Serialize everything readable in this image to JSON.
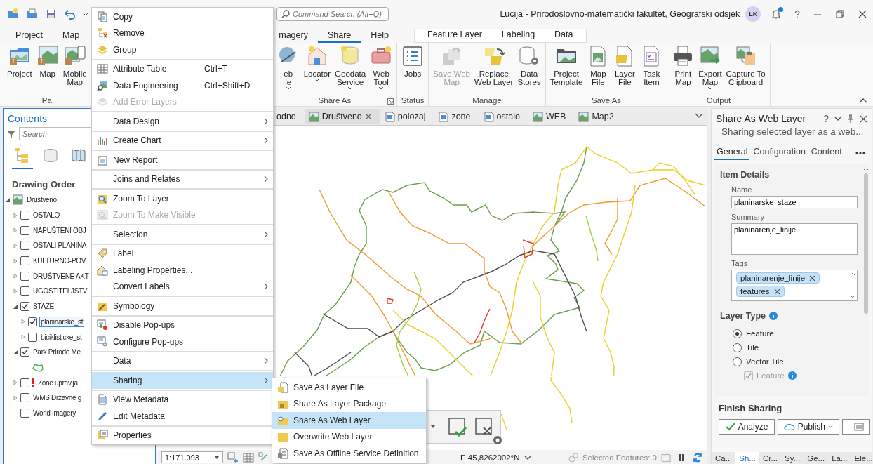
{
  "title_bar": {
    "search": {
      "placeholder": "Command Search (Alt+Q)"
    },
    "title": "Lucija - Prirodoslovno-matematički fakultet, Geografski odsjek",
    "avatar": "LK",
    "notification": true,
    "help": "?"
  },
  "ribbon": {
    "tabs": [
      {
        "label": "Project",
        "selected": false
      },
      {
        "label": "Map",
        "selected": false
      },
      {
        "label": "magery",
        "selected": false
      },
      {
        "label": "Share",
        "selected": true
      },
      {
        "label": "Help",
        "selected": false
      }
    ],
    "contextual_tabs": [
      {
        "label": "Feature Layer",
        "selected": false
      },
      {
        "label": "Labeling",
        "selected": false
      },
      {
        "label": "Data",
        "selected": false
      }
    ],
    "groups": [
      {
        "label": "Pa",
        "buttons": [
          {
            "label": "Project",
            "dropdown": false,
            "disabled": false
          },
          {
            "label": "Map",
            "dropdown": false,
            "disabled": false
          },
          {
            "label": "Mobile\nMap",
            "dropdown": false,
            "disabled": false
          }
        ]
      },
      {
        "label": "Share As",
        "launcher": true,
        "buttons": [
          {
            "label": "eb\nle",
            "dropdown": true,
            "disabled": false
          },
          {
            "label": "Locator",
            "dropdown": true,
            "disabled": false
          },
          {
            "label": "Geodata\nService",
            "dropdown": true,
            "disabled": false
          },
          {
            "label": "Web\nTool",
            "dropdown": true,
            "disabled": false
          }
        ]
      },
      {
        "label": "Status",
        "buttons": [
          {
            "label": "Jobs",
            "dropdown": false,
            "disabled": false
          }
        ]
      },
      {
        "label": "Manage",
        "buttons": [
          {
            "label": "Save Web\nMap",
            "dropdown": false,
            "disabled": true
          },
          {
            "label": "Replace\nWeb Layer",
            "dropdown": false,
            "disabled": false
          },
          {
            "label": "Data\nStores",
            "dropdown": false,
            "disabled": false
          }
        ]
      },
      {
        "label": "Save As",
        "buttons": [
          {
            "label": "Project\nTemplate",
            "dropdown": false,
            "disabled": false
          },
          {
            "label": "Map\nFile",
            "dropdown": false,
            "disabled": false
          },
          {
            "label": "Layer\nFile",
            "dropdown": false,
            "disabled": false
          },
          {
            "label": "Task\nItem",
            "dropdown": false,
            "disabled": false
          }
        ]
      },
      {
        "label": "Output",
        "buttons": [
          {
            "label": "Print\nMap",
            "dropdown": false,
            "disabled": false
          },
          {
            "label": "Export\nMap",
            "dropdown": true,
            "disabled": false
          },
          {
            "label": "Capture To\nClipboard",
            "dropdown": false,
            "disabled": false
          }
        ]
      }
    ]
  },
  "contents": {
    "title": "Contents",
    "search": {
      "placeholder": "Search"
    },
    "views": [
      {
        "selected": true
      },
      {
        "selected": false
      },
      {
        "selected": false
      }
    ],
    "heading": "Drawing Order",
    "tree": [
      {
        "label": "Društveno",
        "kind": "map",
        "expanded": true,
        "children": [
          {
            "label": "OSTALO",
            "kind": "layer",
            "checked": false,
            "expanded": false,
            "selected": false
          },
          {
            "label": "NAPUŠTENI OBJ",
            "kind": "layer",
            "checked": false,
            "expanded": false,
            "selected": false
          },
          {
            "label": "OSTALI PLANINA",
            "kind": "layer",
            "checked": false,
            "expanded": false,
            "selected": false
          },
          {
            "label": "KULTURNO-POV",
            "kind": "layer",
            "checked": false,
            "expanded": false,
            "selected": false
          },
          {
            "label": "DRUŠTVENE AKT",
            "kind": "layer",
            "checked": false,
            "expanded": false,
            "selected": false
          },
          {
            "label": "UGOSTITELJSTV",
            "kind": "layer",
            "checked": false,
            "expanded": false,
            "selected": false
          },
          {
            "label": "STAZE",
            "kind": "layer",
            "checked": true,
            "expanded": true,
            "selected": false,
            "children": [
              {
                "label": "planinarske_st",
                "kind": "layer",
                "checked": true,
                "expanded": false,
                "selected": true
              },
              {
                "label": "biciklisticke_st",
                "kind": "layer",
                "checked": false,
                "expanded": false,
                "selected": false
              }
            ]
          },
          {
            "label": "Park Prirode Me",
            "kind": "layer",
            "checked": true,
            "expanded": true,
            "selected": false,
            "children": [
              {
                "kind": "symbol"
              }
            ]
          },
          {
            "label": "Zone upravlja",
            "kind": "layer",
            "checked": false,
            "expanded": false,
            "selected": false,
            "warning": true
          },
          {
            "label": "WMS Državne g",
            "kind": "layer",
            "checked": false,
            "expanded": false,
            "selected": false
          },
          {
            "label": "World Imagery",
            "kind": "basemap",
            "checked": false,
            "selected": false
          }
        ]
      }
    ]
  },
  "map": {
    "tabs": [
      {
        "label": "odno",
        "kind": "partial",
        "selected": false
      },
      {
        "label": "Društveno",
        "kind": "map",
        "selected": true
      },
      {
        "label": "polozaj",
        "kind": "layout",
        "selected": false
      },
      {
        "label": "zone",
        "kind": "layout",
        "selected": false
      },
      {
        "label": "ostalo",
        "kind": "layout",
        "selected": false
      },
      {
        "label": "WEB",
        "kind": "map",
        "selected": false
      },
      {
        "label": "Map2",
        "kind": "map",
        "selected": false
      }
    ],
    "status_bar": {
      "scale": "1:171.093",
      "coordinates": "E 45,8262002°N",
      "selected_features": "Selected Features: 0"
    }
  },
  "context_menu": {
    "sections": [
      [
        {
          "label": "Copy",
          "submenu": false,
          "disabled": false,
          "selected": false
        },
        {
          "label": "Remove",
          "submenu": false,
          "disabled": false,
          "selected": false
        },
        {
          "label": "Group",
          "submenu": false,
          "disabled": false,
          "selected": false
        }
      ],
      [
        {
          "label": "Attribute Table",
          "shortcut": "Ctrl+T",
          "submenu": false,
          "disabled": false,
          "selected": false
        },
        {
          "label": "Data Engineering",
          "shortcut": "Ctrl+Shift+D",
          "submenu": false,
          "disabled": false,
          "selected": false
        },
        {
          "label": "Add Error Layers",
          "submenu": false,
          "disabled": true,
          "selected": false
        }
      ],
      [
        {
          "label": "Data Design",
          "submenu": true,
          "disabled": false,
          "selected": false
        }
      ],
      [
        {
          "label": "Create Chart",
          "submenu": true,
          "disabled": false,
          "selected": false
        }
      ],
      [
        {
          "label": "New Report",
          "submenu": false,
          "disabled": false,
          "selected": false
        }
      ],
      [
        {
          "label": "Joins and Relates",
          "submenu": true,
          "disabled": false,
          "selected": false
        }
      ],
      [
        {
          "label": "Zoom To Layer",
          "submenu": false,
          "disabled": false,
          "selected": false
        },
        {
          "label": "Zoom To Make Visible",
          "submenu": false,
          "disabled": true,
          "selected": false
        }
      ],
      [
        {
          "label": "Selection",
          "submenu": true,
          "disabled": false,
          "selected": false
        }
      ],
      [
        {
          "label": "Label",
          "submenu": false,
          "disabled": false,
          "selected": false
        },
        {
          "label": "Labeling Properties...",
          "submenu": false,
          "disabled": false,
          "selected": false
        },
        {
          "label": "Convert Labels",
          "submenu": true,
          "disabled": false,
          "selected": false
        }
      ],
      [
        {
          "label": "Symbology",
          "submenu": false,
          "disabled": false,
          "selected": false
        }
      ],
      [
        {
          "label": "Disable Pop-ups",
          "submenu": false,
          "disabled": false,
          "selected": false
        },
        {
          "label": "Configure Pop-ups",
          "submenu": false,
          "disabled": false,
          "selected": false
        }
      ],
      [
        {
          "label": "Data",
          "submenu": true,
          "disabled": false,
          "selected": false
        }
      ],
      [
        {
          "label": "Sharing",
          "submenu": true,
          "disabled": false,
          "selected": true
        }
      ],
      [
        {
          "label": "View Metadata",
          "submenu": false,
          "disabled": false,
          "selected": false
        },
        {
          "label": "Edit Metadata",
          "submenu": false,
          "disabled": false,
          "selected": false
        }
      ],
      [
        {
          "label": "Properties",
          "submenu": false,
          "disabled": false,
          "selected": false
        }
      ]
    ]
  },
  "submenu": {
    "items": [
      {
        "label": "Save As Layer File",
        "selected": false
      },
      {
        "label": "Share As Layer Package",
        "selected": false
      },
      {
        "label": "Share As Web Layer",
        "selected": true
      },
      {
        "label": "Overwrite Web Layer",
        "selected": false
      },
      {
        "label": "Save As Offline Service Definition",
        "selected": false
      }
    ]
  },
  "share_pane": {
    "title": "Share As Web Layer",
    "help": "?",
    "subtitle": "Sharing selected layer as a web...",
    "tabs": [
      {
        "label": "General",
        "selected": true
      },
      {
        "label": "Configuration",
        "selected": false
      },
      {
        "label": "Content",
        "selected": false
      }
    ],
    "item_details": {
      "heading": "Item Details",
      "name": {
        "label": "Name",
        "value": "planinarske_staze"
      },
      "summary": {
        "label": "Summary",
        "value": "planinarenje_linije"
      },
      "tags": {
        "label": "Tags",
        "items": [
          "planinarenje_linije",
          "features"
        ]
      }
    },
    "layer_type": {
      "heading": "Layer Type",
      "options": [
        {
          "label": "Feature",
          "selected": true
        },
        {
          "label": "Tile",
          "selected": false
        },
        {
          "label": "Vector Tile",
          "selected": false
        }
      ],
      "sub_option": {
        "label": "Feature",
        "checked": true,
        "disabled": true
      }
    },
    "finish": {
      "heading": "Finish Sharing",
      "buttons": [
        {
          "kind": "analyze",
          "label": "Analyze"
        },
        {
          "kind": "publish",
          "label": "Publish"
        },
        {
          "kind": "list"
        }
      ]
    },
    "bottom_tabs": [
      {
        "label": "Ca...",
        "selected": false
      },
      {
        "label": "Sh...",
        "selected": true
      },
      {
        "label": "Cr...",
        "selected": false
      },
      {
        "label": "Sy...",
        "selected": false
      },
      {
        "label": "Ge...",
        "selected": false
      },
      {
        "label": "La...",
        "selected": false
      },
      {
        "label": "Ele...",
        "selected": false
      }
    ]
  }
}
